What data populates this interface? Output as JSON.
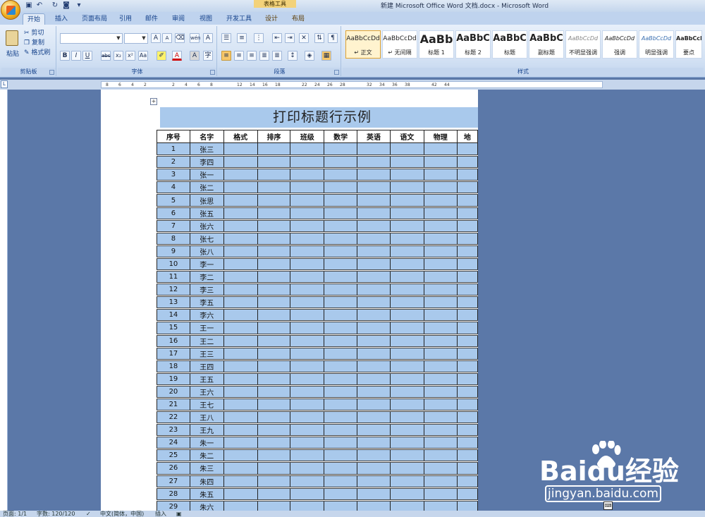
{
  "titlebar": {
    "context_tab_title": "表格工具",
    "window_title": "新建 Microsoft Office Word 文档.docx - Microsoft Word"
  },
  "tabs": [
    {
      "label": "开始",
      "active": true
    },
    {
      "label": "插入"
    },
    {
      "label": "页面布局"
    },
    {
      "label": "引用"
    },
    {
      "label": "邮件"
    },
    {
      "label": "审阅"
    },
    {
      "label": "视图"
    },
    {
      "label": "开发工具"
    },
    {
      "label": "设计",
      "contextual": true
    },
    {
      "label": "布局",
      "contextual": true
    }
  ],
  "ribbon": {
    "clipboard": {
      "label": "剪贴板",
      "paste": "粘贴",
      "cut": "剪切",
      "copy": "复制",
      "format_painter": "格式刷"
    },
    "font": {
      "label": "字体",
      "bold": "B",
      "italic": "I",
      "underline": "U",
      "strike": "abc",
      "subscript": "x₂",
      "superscript": "x²",
      "change_case": "Aa",
      "grow": "A",
      "shrink": "A",
      "font_color": "A",
      "char_border": "A",
      "char_shading": "A",
      "phonetic": "wén",
      "enclose": "字"
    },
    "paragraph": {
      "label": "段落"
    },
    "styles": {
      "label": "样式",
      "items": [
        {
          "sample": "AaBbCcDd",
          "name": "↵ 正文",
          "selected": true
        },
        {
          "sample": "AaBbCcDd",
          "name": "↵ 无间隔"
        },
        {
          "sample": "AaBb",
          "name": "标题 1"
        },
        {
          "sample": "AaBbC",
          "name": "标题 2"
        },
        {
          "sample": "AaBbC",
          "name": "标题"
        },
        {
          "sample": "AaBbC",
          "name": "副标题"
        },
        {
          "sample": "AaBbCcDd",
          "name": "不明显强调"
        },
        {
          "sample": "AaBbCcDd",
          "name": "强调"
        },
        {
          "sample": "AaBbCcDd",
          "name": "明显强调"
        },
        {
          "sample": "AaBbCcDd",
          "name": "要点"
        }
      ]
    }
  },
  "ruler": {
    "ticks": [
      "8",
      "6",
      "4",
      "2",
      "2",
      "4",
      "6",
      "8",
      "12",
      "14",
      "16",
      "18",
      "22",
      "24",
      "26",
      "28",
      "32",
      "34",
      "36",
      "38",
      "42",
      "44"
    ]
  },
  "document": {
    "title": "打印标题行示例",
    "headers": [
      "序号",
      "名字",
      "格式",
      "排序",
      "班级",
      "数学",
      "英语",
      "语文",
      "物理",
      "地"
    ],
    "rows": [
      [
        "1",
        "张三"
      ],
      [
        "2",
        "李四"
      ],
      [
        "3",
        "张一"
      ],
      [
        "4",
        "张二"
      ],
      [
        "5",
        "张思"
      ],
      [
        "6",
        "张五"
      ],
      [
        "7",
        "张六"
      ],
      [
        "8",
        "张七"
      ],
      [
        "9",
        "张八"
      ],
      [
        "10",
        "李一"
      ],
      [
        "11",
        "李二"
      ],
      [
        "12",
        "李三"
      ],
      [
        "13",
        "李五"
      ],
      [
        "14",
        "李六"
      ],
      [
        "15",
        "王一"
      ],
      [
        "16",
        "王二"
      ],
      [
        "17",
        "王三"
      ],
      [
        "18",
        "王四"
      ],
      [
        "19",
        "王五"
      ],
      [
        "20",
        "王六"
      ],
      [
        "21",
        "王七"
      ],
      [
        "22",
        "王八"
      ],
      [
        "23",
        "王九"
      ],
      [
        "24",
        "朱一"
      ],
      [
        "25",
        "朱二"
      ],
      [
        "26",
        "朱三"
      ],
      [
        "27",
        "朱四"
      ],
      [
        "28",
        "朱五"
      ],
      [
        "29",
        "朱六"
      ]
    ]
  },
  "statusbar": {
    "page": "页面: 1/1",
    "words": "字数: 120/120",
    "language": "中文(简体，中国)",
    "mode": "插入"
  },
  "watermark": {
    "brand": "Baidu经验",
    "url": "jingyan.baidu.com"
  },
  "colors": {
    "table_fill": "#a9c9ec",
    "workspace": "#5b78a8"
  }
}
